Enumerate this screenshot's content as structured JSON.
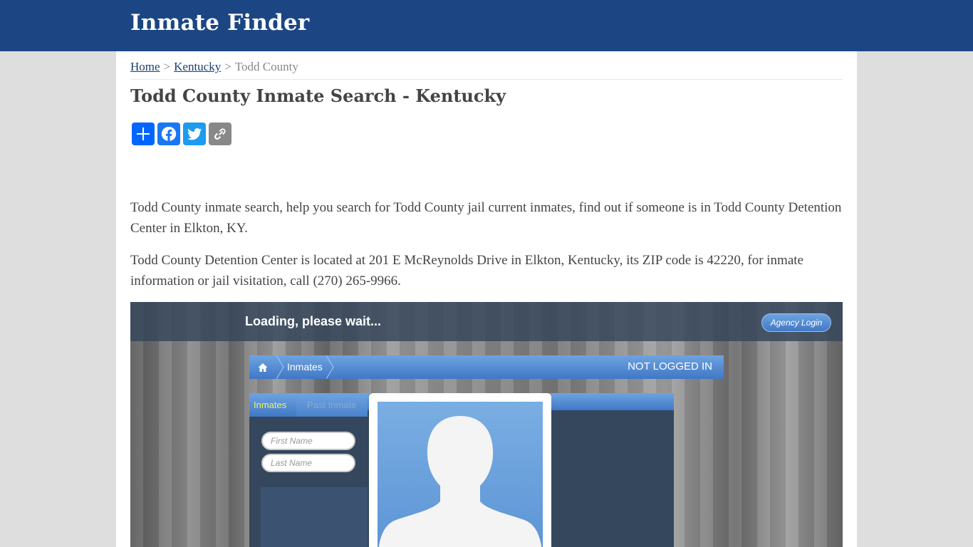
{
  "site": {
    "title": "Inmate Finder"
  },
  "breadcrumb": {
    "home": "Home",
    "separator": ">",
    "state": "Kentucky",
    "current": "Todd County"
  },
  "page": {
    "title": "Todd County Inmate Search - Kentucky"
  },
  "share": [
    {
      "label": "Share",
      "icon": "plus-icon",
      "color": "#0166ff"
    },
    {
      "label": "Facebook",
      "icon": "facebook-icon",
      "color": "#1877f2"
    },
    {
      "label": "Twitter",
      "icon": "twitter-icon",
      "color": "#1d9bf0"
    },
    {
      "label": "Copy Link",
      "icon": "link-icon",
      "color": "#888888"
    }
  ],
  "paragraphs": [
    "Todd County inmate search, help you search for Todd County jail current inmates, find out if someone is in Todd County Detention Center in Elkton, KY.",
    "Todd County Detention Center is located at 201 E McReynolds Drive in Elkton, Kentucky, its ZIP code is 42220, for inmate information or jail visitation, call (270) 265-9966."
  ],
  "embed": {
    "loading_text": "Loading, please wait...",
    "agency_login": "Agency Login",
    "nav_inmates": "Inmates",
    "nav_status": "NOT LOGGED IN",
    "tab_inmates": "Inmates",
    "tab_past": "Past Inmate",
    "first_name_placeholder": "First Name",
    "last_name_placeholder": "Last Name"
  },
  "colors": {
    "header_bg": "#1c4683",
    "link": "#1c3f6e",
    "accent_blue": "#3f78c6",
    "tab_active_text": "#f7f25e"
  }
}
